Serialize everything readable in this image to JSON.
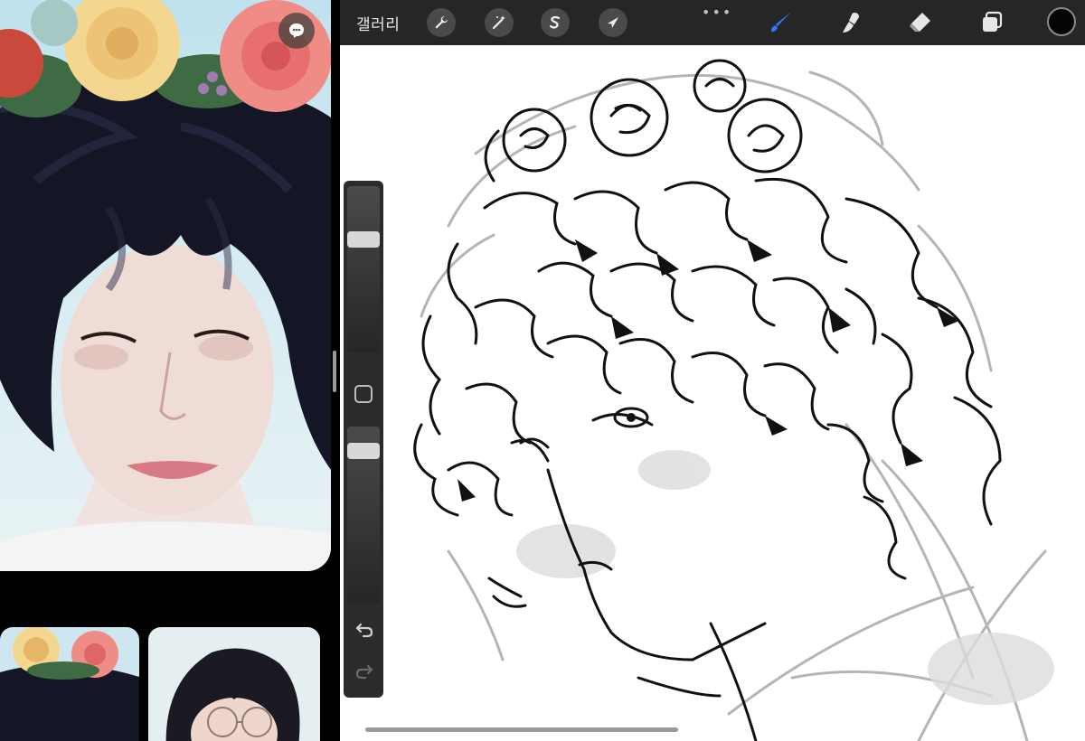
{
  "toolbar": {
    "gallery_label": "갤러리",
    "more_label": "•••",
    "actions_icon": "wrench-icon",
    "adjustments_icon": "magic-wand-icon",
    "selection_icon": "selection-s-icon",
    "transform_icon": "arrow-cursor-icon",
    "brush_icon": "brush-icon",
    "smudge_icon": "smudge-icon",
    "eraser_icon": "eraser-icon",
    "layers_icon": "layers-icon",
    "active_color": "#050505",
    "brush_accent": "#2f7bff"
  },
  "sidebar": {
    "brush_size_level": 0.3,
    "opacity_level": 0.1,
    "undo_icon": "undo-icon",
    "redo_icon": "redo-icon",
    "modify_icon": "square-modify-icon"
  },
  "reference": {
    "comment_icon": "speech-bubble-icon"
  }
}
